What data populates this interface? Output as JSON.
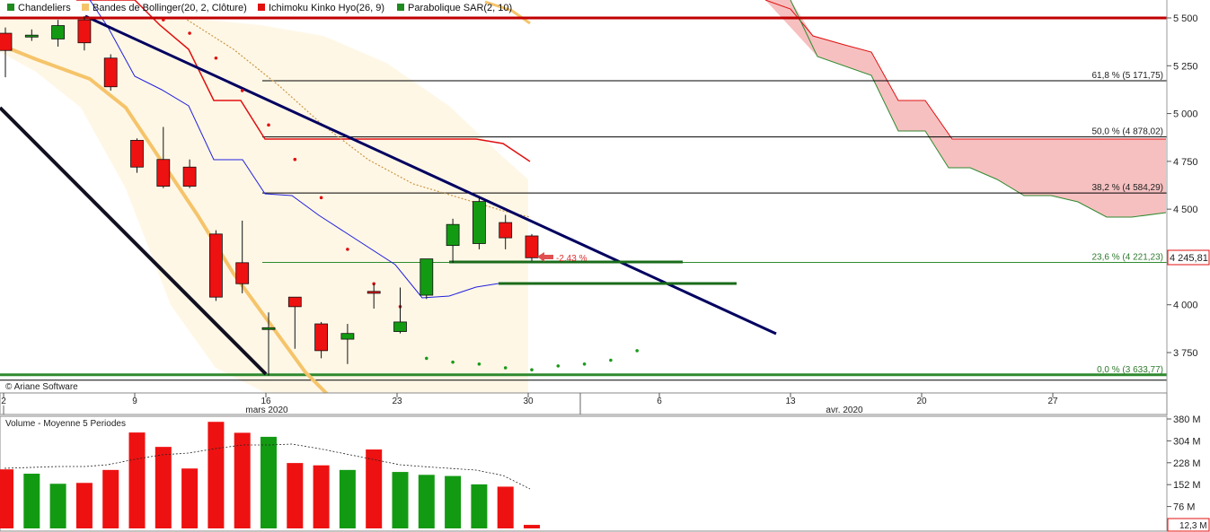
{
  "legend": [
    {
      "label": "Chandeliers",
      "color": "#1f8a1f"
    },
    {
      "label": "Bandes de Bollinger(20, 2, Clôture)",
      "color": "#f5c46a"
    },
    {
      "label": "Ichimoku Kinko Hyo(26, 9)",
      "color": "#e01010"
    },
    {
      "label": "Parabolique SAR(2, 10)",
      "color": "#1f8a1f"
    }
  ],
  "copyright": "© Ariane Software",
  "price_badge": "4 245,81",
  "pct_annotation": "-2,43 %",
  "fib_levels": [
    {
      "label": "61,8 % (5 171,75)",
      "value": 5171.75
    },
    {
      "label": "50,0 % (4 878,02)",
      "value": 4878.02
    },
    {
      "label": "38,2 % (4 584,29)",
      "value": 4584.29
    },
    {
      "label": "23,6 % (4 221,23)",
      "value": 4221.23
    },
    {
      "label": "0,0 % (3 633,77)",
      "value": 3633.77
    }
  ],
  "price_axis": [
    "5 500",
    "5 250",
    "5 000",
    "4 750",
    "4 500",
    "4 000",
    "3 750"
  ],
  "date_axis": {
    "day_ticks": [
      "2",
      "9",
      "16",
      "23",
      "30",
      "6",
      "13",
      "20",
      "27"
    ],
    "months": [
      "mars 2020",
      "avr. 2020"
    ]
  },
  "volume_panel": {
    "title": "Volume  - Moyenne 5 Periodes",
    "axis": [
      "380 M",
      "304 M",
      "228 M",
      "152 M",
      "76 M"
    ],
    "last_badge": "12,3 M"
  },
  "colors": {
    "up": "#139a13",
    "down": "#ee1111",
    "trend": "#000060",
    "fib": "#000000",
    "support": "#1a6b1a"
  },
  "chart_data": {
    "type": "candlestick",
    "x_unit": "trading day",
    "y_range": [
      3620,
      5560
    ],
    "candles": [
      {
        "date": "2020-03-02",
        "open": 5420,
        "high": 5450,
        "low": 5190,
        "close": 5330
      },
      {
        "date": "2020-03-03",
        "open": 5400,
        "high": 5440,
        "low": 5380,
        "close": 5410
      },
      {
        "date": "2020-03-04",
        "open": 5390,
        "high": 5490,
        "low": 5350,
        "close": 5460
      },
      {
        "date": "2020-03-05",
        "open": 5490,
        "high": 5510,
        "low": 5330,
        "close": 5370
      },
      {
        "date": "2020-03-06",
        "open": 5290,
        "high": 5310,
        "low": 5120,
        "close": 5140
      },
      {
        "date": "2020-03-09",
        "open": 4860,
        "high": 4870,
        "low": 4690,
        "close": 4720
      },
      {
        "date": "2020-03-10",
        "open": 4760,
        "high": 4930,
        "low": 4610,
        "close": 4620
      },
      {
        "date": "2020-03-11",
        "open": 4720,
        "high": 4760,
        "low": 4610,
        "close": 4620
      },
      {
        "date": "2020-03-12",
        "open": 4370,
        "high": 4390,
        "low": 4020,
        "close": 4040
      },
      {
        "date": "2020-03-13",
        "open": 4220,
        "high": 4440,
        "low": 4060,
        "close": 4110
      },
      {
        "date": "2020-03-16",
        "open": 3880,
        "high": 3960,
        "low": 3630,
        "close": 3880
      },
      {
        "date": "2020-03-17",
        "open": 4040,
        "high": 4040,
        "low": 3770,
        "close": 3990
      },
      {
        "date": "2020-03-18",
        "open": 3900,
        "high": 3910,
        "low": 3720,
        "close": 3760
      },
      {
        "date": "2020-03-19",
        "open": 3820,
        "high": 3900,
        "low": 3690,
        "close": 3850
      },
      {
        "date": "2020-03-20",
        "open": 4070,
        "high": 4110,
        "low": 3980,
        "close": 4060
      },
      {
        "date": "2020-03-23",
        "open": 3860,
        "high": 4090,
        "low": 3850,
        "close": 3910
      },
      {
        "date": "2020-03-24",
        "open": 4050,
        "high": 4240,
        "low": 4030,
        "close": 4240
      },
      {
        "date": "2020-03-25",
        "open": 4310,
        "high": 4450,
        "low": 4220,
        "close": 4420
      },
      {
        "date": "2020-03-26",
        "open": 4320,
        "high": 4560,
        "low": 4290,
        "close": 4540
      },
      {
        "date": "2020-03-27",
        "open": 4430,
        "high": 4470,
        "low": 4290,
        "close": 4350
      },
      {
        "date": "2020-03-30",
        "open": 4360,
        "high": 4370,
        "low": 4230,
        "close": 4245.81
      }
    ],
    "volume": [
      205,
      190,
      155,
      158,
      203,
      333,
      283,
      208,
      370,
      332,
      318,
      227,
      219,
      203,
      274,
      196,
      186,
      182,
      153,
      145,
      12.3
    ],
    "volume_ylim": [
      0,
      380
    ]
  }
}
